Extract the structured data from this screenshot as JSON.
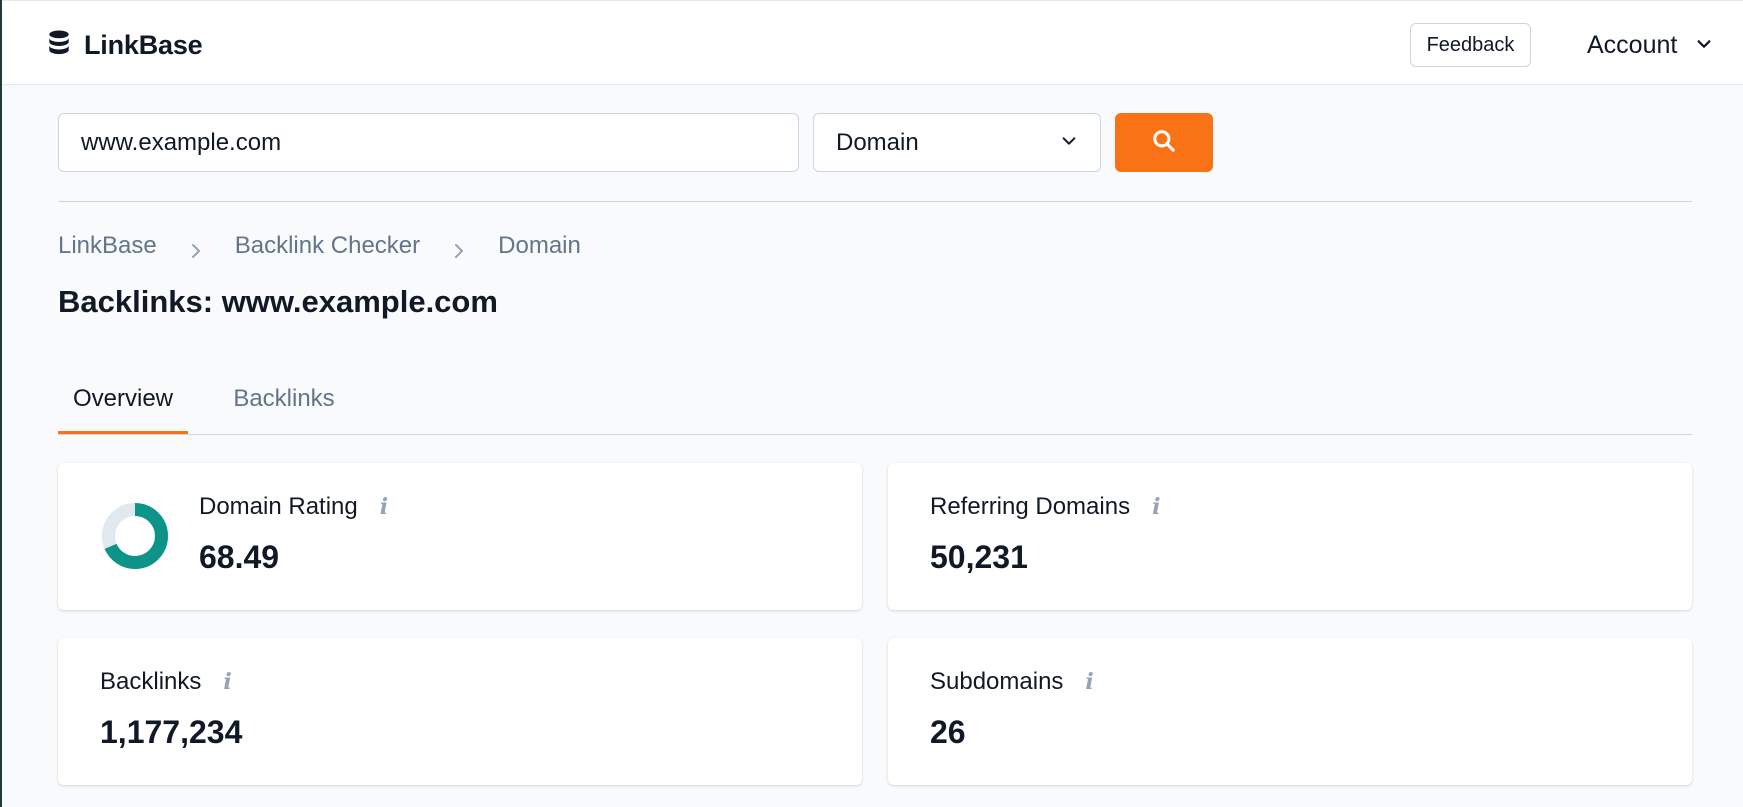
{
  "app": {
    "name": "LinkBase",
    "logo_icon": "database-icon"
  },
  "header": {
    "feedback_label": "Feedback",
    "account_label": "Account"
  },
  "search": {
    "value": "www.example.com",
    "mode_selected": "Domain",
    "accent_color": "#f97316"
  },
  "breadcrumb": [
    "LinkBase",
    "Backlink Checker",
    "Domain"
  ],
  "page_title": "Backlinks: www.example.com",
  "tabs": [
    {
      "label": "Overview",
      "active": true
    },
    {
      "label": "Backlinks",
      "active": false
    }
  ],
  "metrics": {
    "domain_rating": {
      "label": "Domain Rating",
      "value": "68.49",
      "fraction": 0.6849,
      "ring_color": "#0d9488",
      "track_color": "#e2e8f0"
    },
    "referring_domains": {
      "label": "Referring Domains",
      "value": "50,231"
    },
    "backlinks": {
      "label": "Backlinks",
      "value": "1,177,234"
    },
    "subdomains": {
      "label": "Subdomains",
      "value": "26"
    }
  },
  "info_glyph": "i"
}
